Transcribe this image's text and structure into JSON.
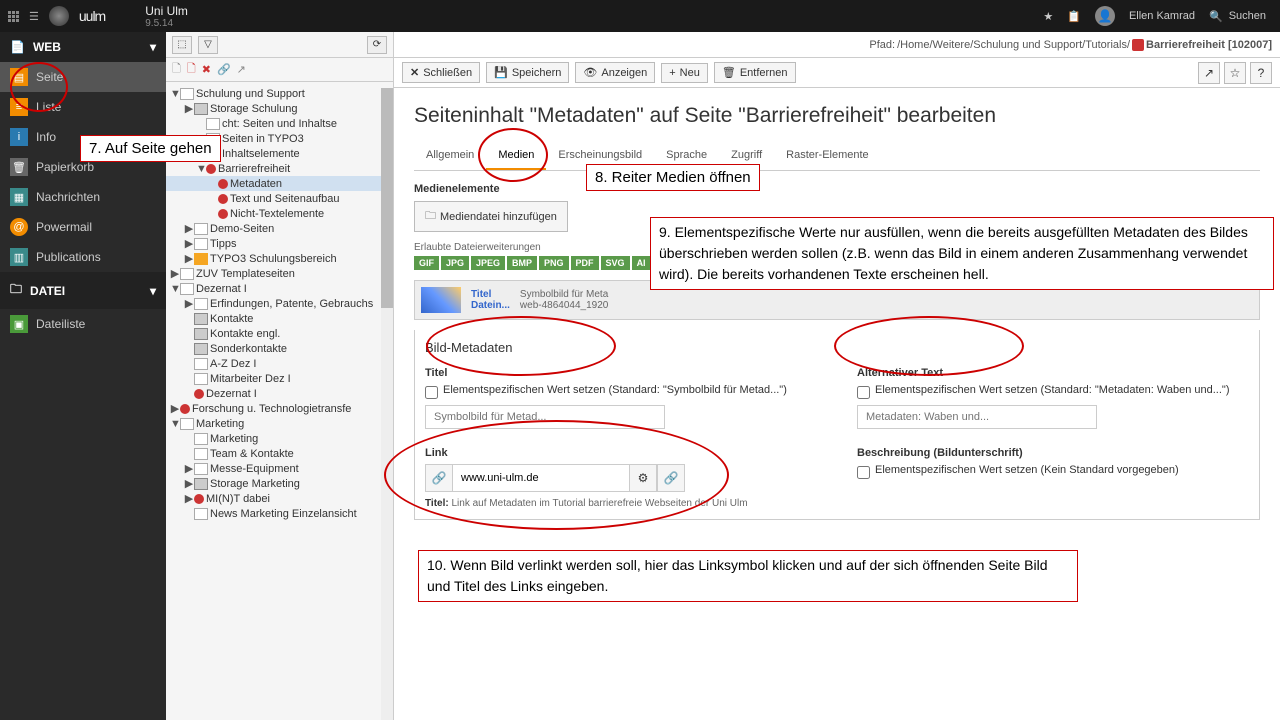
{
  "topbar": {
    "logo_text": "uulm",
    "site_name": "Uni Ulm",
    "version": "9.5.14",
    "user_name": "Ellen Kamrad",
    "search_label": "Suchen"
  },
  "sidebar": {
    "group_web": "WEB",
    "group_datei": "DATEI",
    "items_web": [
      "Seite",
      "Liste",
      "Info",
      "Papierkorb",
      "Nachrichten",
      "Powermail",
      "Publications"
    ],
    "items_datei": [
      "Dateiliste"
    ]
  },
  "tree": {
    "n0": "Schulung und Support",
    "n1": "Storage Schulung",
    "n2": "cht: Seiten und Inhaltse",
    "n3": "Seiten in TYPO3",
    "n4": "Inhaltselemente",
    "n5": "Barrierefreiheit",
    "n6": "Metadaten",
    "n7": "Text und Seitenaufbau",
    "n8": "Nicht-Textelemente",
    "n9": "Demo-Seiten",
    "n10": "Tipps",
    "n11": "TYPO3 Schulungsbereich",
    "n12": "ZUV Templateseiten",
    "n13": "Dezernat I",
    "n14": "Erfindungen, Patente, Gebrauchs",
    "n15": "Kontakte",
    "n16": "Kontakte engl.",
    "n17": "Sonderkontakte",
    "n18": "A-Z Dez I",
    "n19": "Mitarbeiter Dez I",
    "n20": "Dezernat I",
    "n21": "Forschung u. Technologietransfe",
    "n22": "Marketing",
    "n23": "Marketing",
    "n24": "Team & Kontakte",
    "n25": "Messe-Equipment",
    "n26": "Storage Marketing",
    "n27": "MI(N)T dabei",
    "n28": "News Marketing Einzelansicht"
  },
  "content": {
    "path_prefix": "Pfad: ",
    "path": "/Home/Weitere/Schulung und Support/Tutorials/ ",
    "path_page": "Barrierefreiheit [102007]",
    "btn_close": "Schließen",
    "btn_save": "Speichern",
    "btn_view": "Anzeigen",
    "btn_new": "Neu",
    "btn_remove": "Entfernen",
    "title": "Seiteninhalt \"Metadaten\" auf Seite \"Barrierefreiheit\" bearbeiten",
    "tabs": [
      "Allgemein",
      "Medien",
      "Erscheinungsbild",
      "Sprache",
      "Zugriff",
      "Raster-Elemente"
    ],
    "sect_media": "Medienelemente",
    "btn_addfile": "Mediendatei hinzufügen",
    "formats_label": "Erlaubte Dateierweiterungen",
    "formats": [
      "GIF",
      "JPG",
      "JPEG",
      "BMP",
      "PNG",
      "PDF",
      "SVG",
      "AI"
    ],
    "media_title_lbl": "Titel",
    "media_file_lbl": "Datein...",
    "media_title_val": "Symbolbild für Meta",
    "media_file_val": "web-4864044_1920",
    "sect_bildmeta": "Bild-Metadaten",
    "f_titel": "Titel",
    "f_alt": "Alternativer Text",
    "f_link": "Link",
    "f_beschr": "Beschreibung (Bildunterschrift)",
    "chk_titel": "Elementspezifischen Wert setzen (Standard: \"Symbolbild für Metad...\")",
    "chk_alt": "Elementspezifischen Wert setzen (Standard: \"Metadaten: Waben und...\")",
    "chk_beschr": "Elementspezifischen Wert setzen (Kein Standard vorgegeben)",
    "ph_titel": "Symbolbild für Metad...",
    "ph_alt": "Metadaten: Waben und...",
    "link_val": "www.uni-ulm.de",
    "link_title_lbl": "Titel:",
    "link_title_val": " Link auf Metadaten im Tutorial barrierefreie Webseiten der Uni Ulm"
  },
  "anno": {
    "a7": "7. Auf Seite gehen",
    "a8": "8. Reiter Medien öffnen",
    "a9": "9. Elementspezifische Werte nur ausfüllen, wenn die bereits ausgefüllten Metadaten des Bildes überschrieben werden sollen (z.B. wenn das Bild in einem anderen Zusammenhang verwendet wird). Die bereits vorhandenen Texte erscheinen hell.",
    "a10": "10. Wenn Bild verlinkt werden soll, hier das Linksymbol klicken und auf der sich öffnenden Seite Bild und Titel des Links eingeben."
  }
}
